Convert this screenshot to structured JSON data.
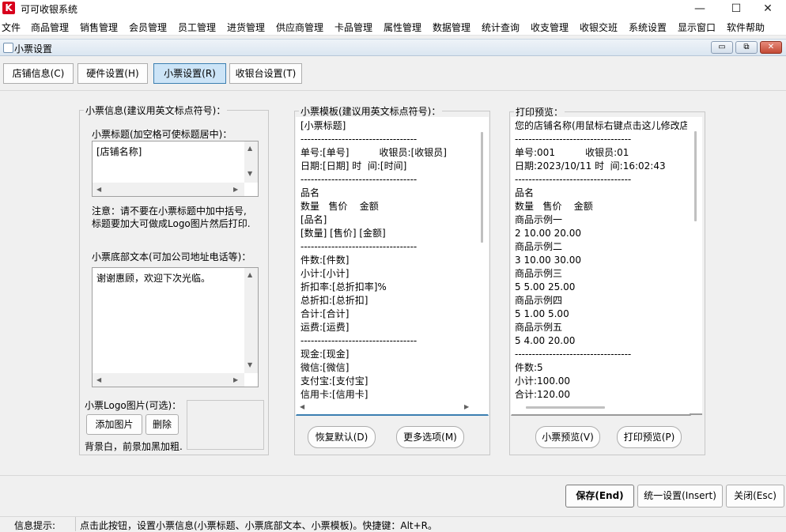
{
  "app": {
    "logo_letter": "K",
    "title": "可可收银系统",
    "window_controls": {
      "minimize": "—",
      "maximize": "☐",
      "close": "✕"
    }
  },
  "menu": [
    "文件",
    "商品管理",
    "销售管理",
    "会员管理",
    "员工管理",
    "进货管理",
    "供应商管理",
    "卡品管理",
    "属性管理",
    "数据管理",
    "统计查询",
    "收支管理",
    "收银交班",
    "系统设置",
    "显示窗口",
    "软件帮助"
  ],
  "child_window": {
    "title": "小票设置",
    "controls": {
      "minimize": "▭",
      "maximize": "⧉",
      "close": "✕"
    }
  },
  "tabs": [
    "店铺信息(C)",
    "硬件设置(H)",
    "小票设置(R)",
    "收银台设置(T)"
  ],
  "active_tab": "小票设置(R)",
  "receipt_info": {
    "legend": "小票信息(建议用英文标点符号)：",
    "title_label": "小票标题(加空格可使标题居中)：",
    "title_value": "[店铺名称]",
    "note_line1": "注意：请不要在小票标题中加中括号,",
    "note_line2": "标题要加大可做成Logo图片然后打印.",
    "footer_label": "小票底部文本(可加公司地址电话等)：",
    "footer_value": "谢谢惠顾，欢迎下次光临。",
    "logo_label": "小票Logo图片(可选)：",
    "add_image": "添加图片",
    "delete": "删除",
    "logo_hint": "背景白，前景加黑加粗."
  },
  "template": {
    "legend": "小票模板(建议用英文标点符号)：",
    "text": "[小票标题]\n----------------------------------\n单号:[单号]          收银员:[收银员]\n日期:[日期] 时  间:[时间]\n----------------------------------\n品名\n数量   售价    金额\n[品名]\n[数量] [售价] [金额]\n----------------------------------\n件数:[件数]\n小计:[小计]\n折扣率:[总折扣率]%\n总折扣:[总折扣]\n合计:[合计]\n运费:[运费]\n----------------------------------\n现金:[现金]\n微信:[微信]\n支付宝:[支付宝]\n信用卡:[信用卡]",
    "restore_default": "恢复默认(D)",
    "more_options": "更多选项(M)"
  },
  "preview": {
    "legend": "打印预览：",
    "text": "您的店铺名称(用鼠标右键点击这儿修改店\n----------------------------------\n单号:001          收银员:01\n日期:2023/10/11 时  间:16:02:43\n----------------------------------\n品名\n数量   售价    金额\n商品示例一\n2 10.00 20.00\n商品示例二\n3 10.00 30.00\n商品示例三\n5 5.00 25.00\n商品示例四\n5 1.00 5.00\n商品示例五\n5 4.00 20.00\n----------------------------------\n件数:5\n小计:100.00\n合计:120.00",
    "receipt_preview": "小票预览(V)",
    "print_preview": "打印预览(P)"
  },
  "footer_buttons": {
    "save": "保存(End)",
    "unify": "统一设置(Insert)",
    "close": "关闭(Esc)"
  },
  "status": {
    "label": "信息提示:",
    "message": "点击此按钮，设置小票信息(小票标题、小票底部文本、小票模板)。快捷键：Alt+R。"
  }
}
